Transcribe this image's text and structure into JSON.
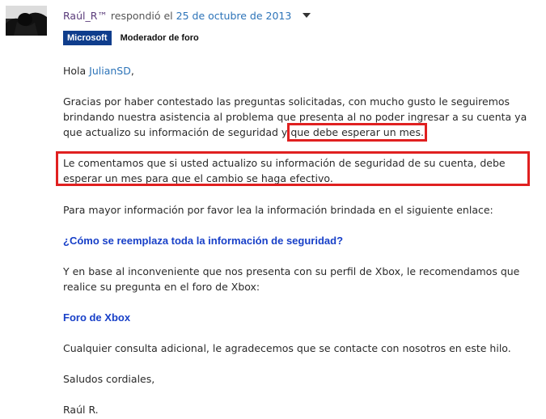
{
  "post": {
    "author": "Raúl_R™",
    "replied_text": "respondió el",
    "date": "25 de octubre de 2013",
    "badge": "Microsoft",
    "role": "Moderador de foro"
  },
  "message": {
    "greeting_prefix": "Hola ",
    "greeting_name": "JulianSD",
    "greeting_suffix": ",",
    "p1_text": "Gracias por haber contestado las preguntas solicitadas, con mucho gusto le seguiremos brindando nuestra asistencia al problema que presenta al no poder ingresar a su cuenta ya que actualizo su información de seguridad y",
    "p1_highlight": "que debe esperar un mes.",
    "p2": "Le comentamos que si usted actualizo su información de seguridad de su cuenta, debe esperar un mes para que el cambio se haga efectivo.",
    "p3": "Para mayor información por favor lea la información brindada en el siguiente enlace:",
    "link1": "¿Cómo se reemplaza toda la información de seguridad?",
    "p4": "Y en base al inconveniente que nos presenta con su perfil de Xbox, le recomendamos que realice su pregunta en el foro de Xbox:",
    "link2": "Foro de Xbox",
    "p5": "Cualquier consulta adicional, le agradecemos que se contacte con nosotros en este hilo.",
    "p6": "Saludos cordiales,",
    "signature": "Raúl R."
  },
  "colors": {
    "author": "#5a3b7a",
    "date_link": "#2c73b8",
    "badge_bg": "#0f3d8c",
    "highlight_border": "#e02020",
    "bold_link": "#1840c8"
  },
  "icons": {
    "avatar": "user-avatar",
    "menu": "chevron-down-icon"
  }
}
